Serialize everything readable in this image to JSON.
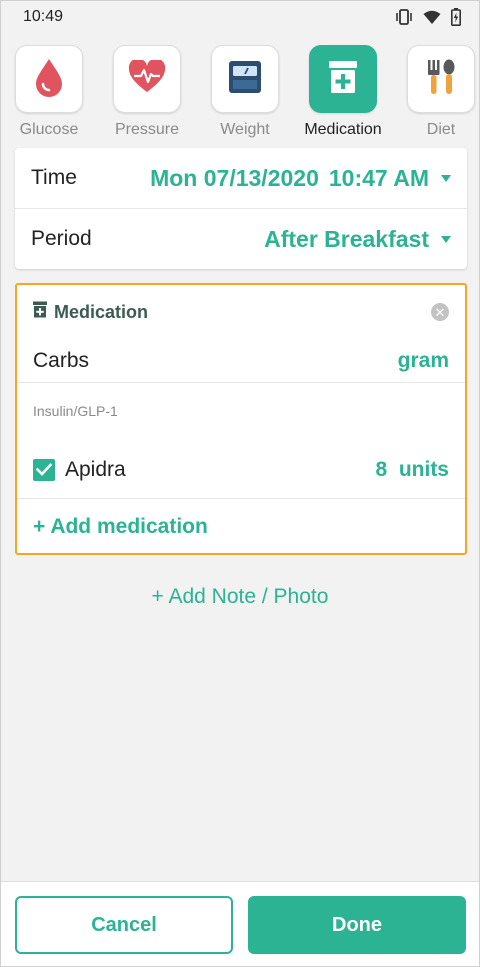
{
  "status_bar": {
    "time": "10:49",
    "icons": [
      "vibrate-icon",
      "wifi-icon",
      "battery-charging-icon"
    ]
  },
  "tabs": [
    {
      "label": "Glucose",
      "icon": "blood-drop-icon",
      "active": false
    },
    {
      "label": "Pressure",
      "icon": "heart-pulse-icon",
      "active": false
    },
    {
      "label": "Weight",
      "icon": "scale-icon",
      "active": false
    },
    {
      "label": "Medication",
      "icon": "medicine-box-icon",
      "active": true
    },
    {
      "label": "Diet",
      "icon": "fork-spoon-icon",
      "active": false
    }
  ],
  "time_row": {
    "label": "Time",
    "date": "Mon 07/13/2020",
    "time": "10:47 AM"
  },
  "period_row": {
    "label": "Period",
    "value": "After Breakfast"
  },
  "medication_card": {
    "title": "Medication",
    "carbs_label": "Carbs",
    "carbs_unit": "gram",
    "section_label": "Insulin/GLP-1",
    "items": [
      {
        "name": "Apidra",
        "amount": "8",
        "unit": "units",
        "checked": true
      }
    ],
    "add_label": "+ Add medication"
  },
  "add_note_label": "+ Add Note / Photo",
  "buttons": {
    "cancel": "Cancel",
    "done": "Done"
  },
  "colors": {
    "accent": "#2bb394",
    "highlight_border": "#f5a623",
    "background": "#f2f2f2"
  }
}
